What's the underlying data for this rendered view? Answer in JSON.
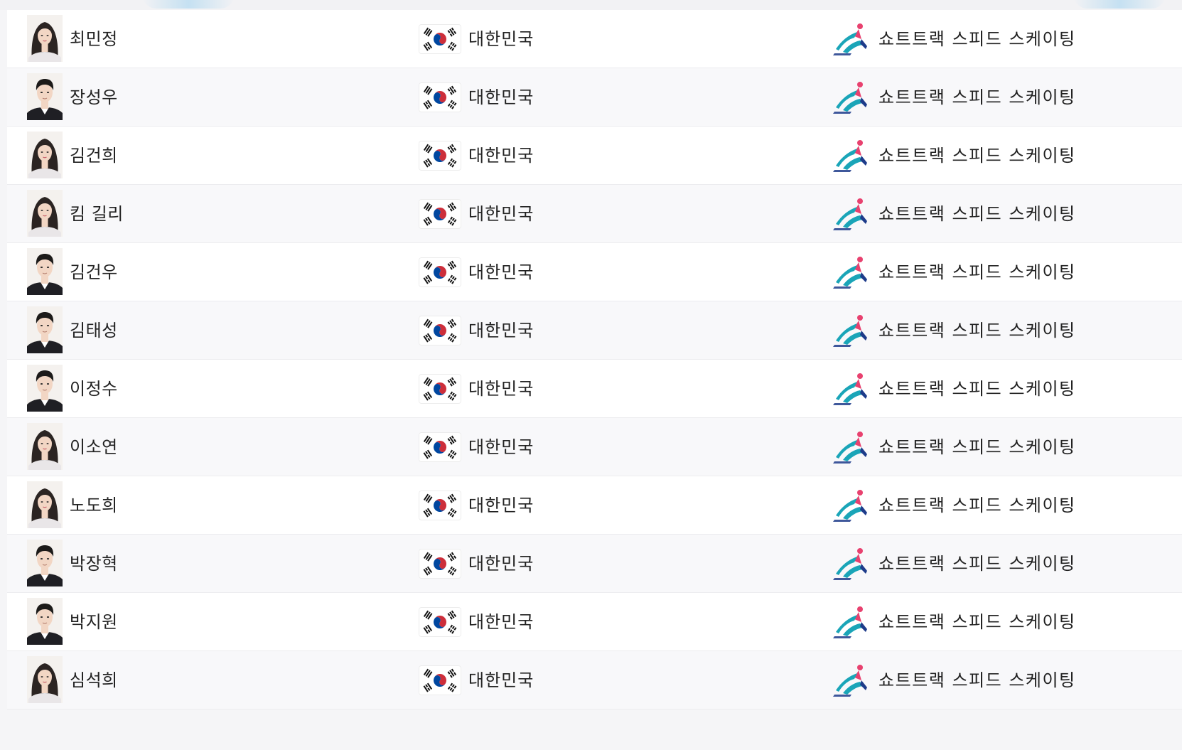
{
  "athletes": [
    {
      "name": "최민정",
      "gender": "female",
      "country": "대한민국",
      "sport": "쇼트트랙 스피드 스케이팅"
    },
    {
      "name": "장성우",
      "gender": "male",
      "country": "대한민국",
      "sport": "쇼트트랙 스피드 스케이팅"
    },
    {
      "name": "김건희",
      "gender": "female",
      "country": "대한민국",
      "sport": "쇼트트랙 스피드 스케이팅"
    },
    {
      "name": "킴 길리",
      "gender": "female",
      "country": "대한민국",
      "sport": "쇼트트랙 스피드 스케이팅"
    },
    {
      "name": "김건우",
      "gender": "male",
      "country": "대한민국",
      "sport": "쇼트트랙 스피드 스케이팅"
    },
    {
      "name": "김태성",
      "gender": "male",
      "country": "대한민국",
      "sport": "쇼트트랙 스피드 스케이팅"
    },
    {
      "name": "이정수",
      "gender": "male",
      "country": "대한민국",
      "sport": "쇼트트랙 스피드 스케이팅"
    },
    {
      "name": "이소연",
      "gender": "female",
      "country": "대한민국",
      "sport": "쇼트트랙 스피드 스케이팅"
    },
    {
      "name": "노도희",
      "gender": "female",
      "country": "대한민국",
      "sport": "쇼트트랙 스피드 스케이팅"
    },
    {
      "name": "박장혁",
      "gender": "male",
      "country": "대한민국",
      "sport": "쇼트트랙 스피드 스케이팅"
    },
    {
      "name": "박지원",
      "gender": "male",
      "country": "대한민국",
      "sport": "쇼트트랙 스피드 스케이팅"
    },
    {
      "name": "심석희",
      "gender": "female",
      "country": "대한민국",
      "sport": "쇼트트랙 스피드 스케이팅"
    }
  ],
  "icons": {
    "photo": "athlete-portrait-icon",
    "flag": "south-korea-flag-icon",
    "sport": "short-track-skater-icon"
  },
  "colors": {
    "row_alt": "#f8f8fa",
    "text": "#222222",
    "flag_red": "#cd2e3a",
    "flag_blue": "#0047a0",
    "sport_teal": "#1aa5b8",
    "sport_pink": "#e8416f",
    "sport_navy": "#1d3b8a"
  }
}
